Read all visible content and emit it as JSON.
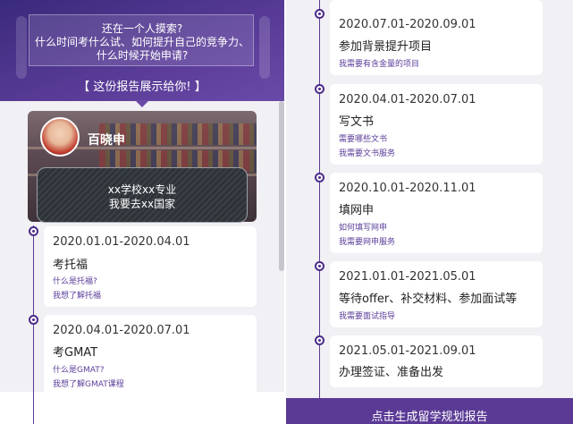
{
  "banner": {
    "line1": "还在一个人摸索?",
    "line2": "什么时间考什么试、如何提升自己的竞争力、",
    "line3": "什么时候开始申请?",
    "cta": "【 这份报告展示给你! 】"
  },
  "profile": {
    "name": "百晓申",
    "board_line1": "xx学校xx专业",
    "board_line2": "我要去xx国家"
  },
  "left_timeline": [
    {
      "date": "2020.01.01-2020.04.01",
      "title": "考托福",
      "links": [
        "什么是托福?",
        "我想了解托福"
      ]
    },
    {
      "date": "2020.04.01-2020.07.01",
      "title": "考GMAT",
      "links": [
        "什么是GMAT?",
        "我想了解GMAT课程"
      ]
    }
  ],
  "right_timeline": [
    {
      "date": "2020.07.01-2020.09.01",
      "title": "参加背景提升项目",
      "links": [
        "我需要有含金量的项目"
      ]
    },
    {
      "date": "2020.04.01-2020.07.01",
      "title": "写文书",
      "links": [
        "需要哪些文书",
        "我需要文书服务"
      ]
    },
    {
      "date": "2020.10.01-2020.11.01",
      "title": "填网申",
      "links": [
        "如何填写网申",
        "我需要网申服务"
      ]
    },
    {
      "date": "2021.01.01-2021.05.01",
      "title": "等待offer、补交材料、参加面试等",
      "links": [
        "我需要面试指导"
      ]
    },
    {
      "date": "2021.05.01-2021.09.01",
      "title": "办理签证、准备出发",
      "links": []
    }
  ],
  "footer": {
    "generate_button": "点击生成留学规划报告"
  },
  "colors": {
    "accent": "#5b3a96",
    "link": "#5a3d99",
    "background": "#f1f0f4"
  }
}
